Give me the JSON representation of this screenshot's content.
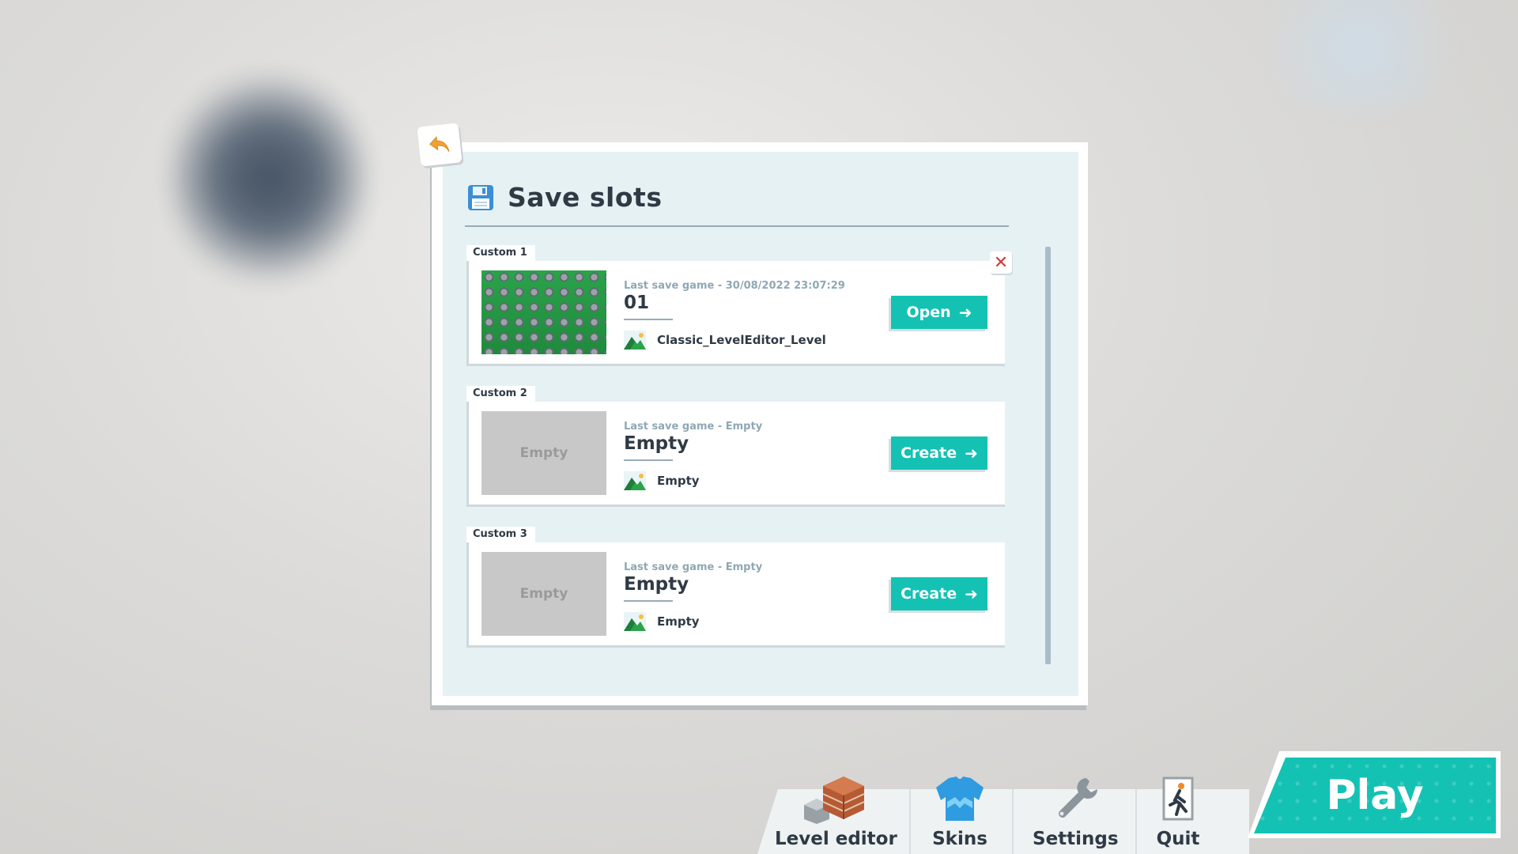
{
  "panel": {
    "title": "Save slots",
    "icons": {
      "title": "floppy-disk-icon",
      "back": "back-arrow-icon",
      "delete": "close-icon"
    }
  },
  "slots": [
    {
      "tab_label": "Custom 1",
      "last_save": "Last save game - 30/08/2022 23:07:29",
      "name": "01",
      "level_name": "Classic_LevelEditor_Level",
      "thumbnail_label": "",
      "action_label": "Open",
      "has_delete": true
    },
    {
      "tab_label": "Custom 2",
      "last_save": "Last save game - Empty",
      "name": "Empty",
      "level_name": "Empty",
      "thumbnail_label": "Empty",
      "action_label": "Create",
      "has_delete": false
    },
    {
      "tab_label": "Custom 3",
      "last_save": "Last save game - Empty",
      "name": "Empty",
      "level_name": "Empty",
      "thumbnail_label": "Empty",
      "action_label": "Create",
      "has_delete": false
    }
  ],
  "bottom_menu": {
    "level_editor": "Level editor",
    "skins": "Skins",
    "settings": "Settings",
    "quit": "Quit",
    "play": "Play"
  },
  "colors": {
    "accent": "#14c2b4",
    "text": "#2f3a45",
    "muted": "#8ea8b3",
    "close": "#d23a3a"
  }
}
